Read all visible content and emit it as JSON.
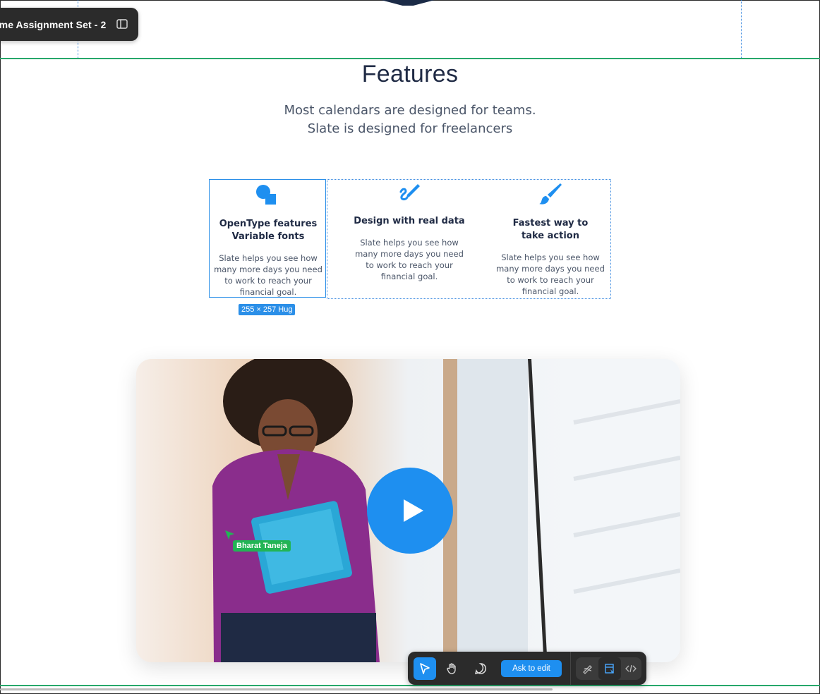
{
  "frame": {
    "name": "ome Assignment Set - 2"
  },
  "features": {
    "title": "Features",
    "subtitle_line1": "Most calendars are designed for teams.",
    "subtitle_line2": "Slate is designed for freelancers",
    "cards": [
      {
        "title_line1": "OpenType features",
        "title_line2": "Variable fonts",
        "icon": "shapes-icon",
        "desc_lines": [
          "Slate helps you see how",
          "many more days you need",
          "to work to reach your",
          "financial goal."
        ]
      },
      {
        "title_line1": "Design with real data",
        "title_line2": "",
        "icon": "pen-icon",
        "desc_lines": [
          "Slate helps you see how",
          "many more days you need",
          "to work to reach your",
          "financial goal."
        ]
      },
      {
        "title_line1": "Fastest way to",
        "title_line2": "take action",
        "icon": "brush-icon",
        "desc_lines": [
          "Slate helps you see how",
          "many more days you need",
          "to work to reach your",
          "financial goal."
        ]
      }
    ]
  },
  "selection_badge": "255 × 257 Hug",
  "collaborator": {
    "name": "Bharat Taneja",
    "color": "#22b455"
  },
  "video": {
    "play_icon": "play-icon"
  },
  "toolbar": {
    "ask_label": "Ask to edit"
  },
  "colors": {
    "accent": "#1e8ff0",
    "frame_guide": "#27a86a",
    "heading": "#1f2a44"
  }
}
